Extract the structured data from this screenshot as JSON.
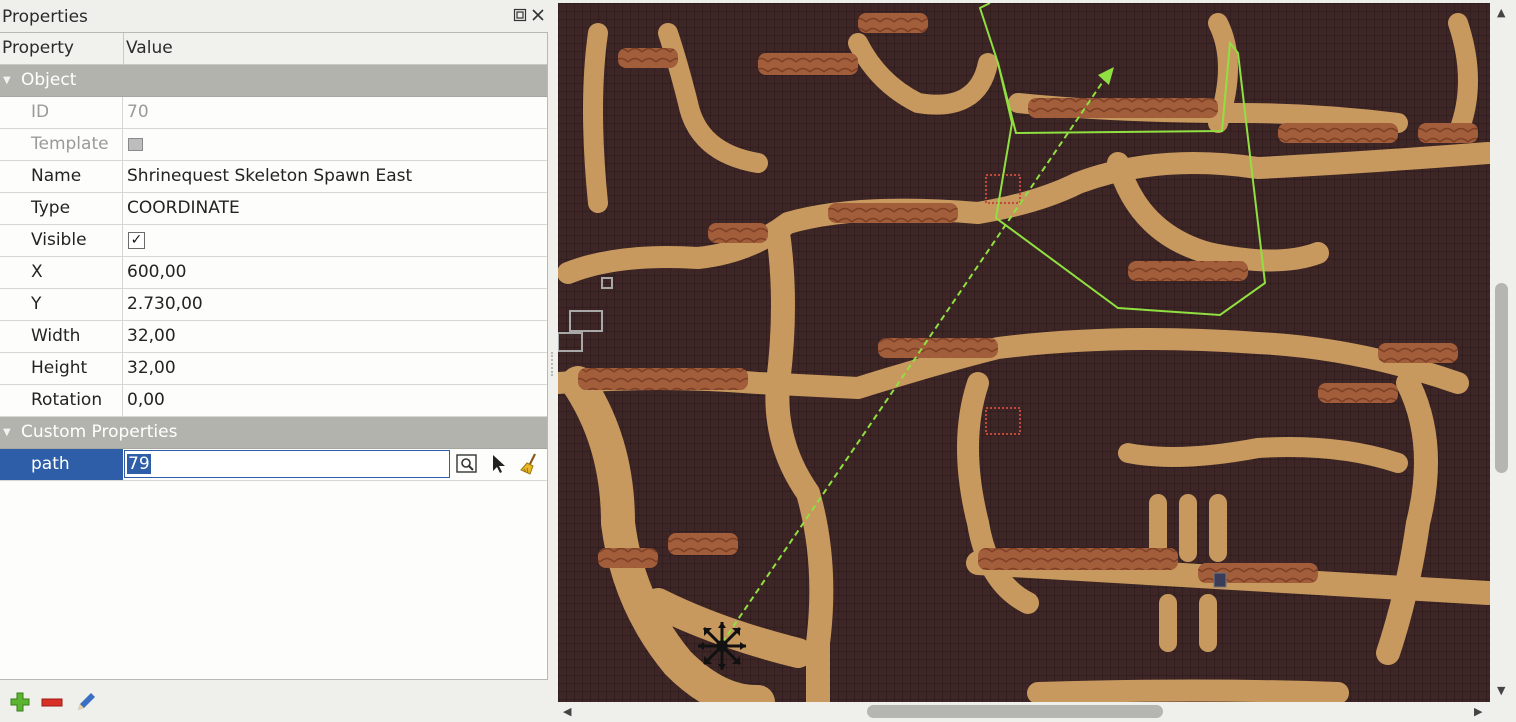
{
  "panel": {
    "title": "Properties",
    "header": {
      "property": "Property",
      "value": "Value"
    },
    "groups": [
      {
        "label": "Object"
      },
      {
        "label": "Custom Properties"
      }
    ],
    "object_rows": [
      {
        "key": "ID",
        "value": "70"
      },
      {
        "key": "Template",
        "value": ""
      },
      {
        "key": "Name",
        "value": "Shrinequest Skeleton Spawn East"
      },
      {
        "key": "Type",
        "value": "COORDINATE"
      },
      {
        "key": "Visible",
        "value": "✓"
      },
      {
        "key": "X",
        "value": "600,00"
      },
      {
        "key": "Y",
        "value": "2.730,00"
      },
      {
        "key": "Width",
        "value": "32,00"
      },
      {
        "key": "Height",
        "value": "32,00"
      },
      {
        "key": "Rotation",
        "value": "0,00"
      }
    ],
    "custom_rows": [
      {
        "key": "path",
        "value": "79"
      }
    ]
  },
  "colors": {
    "selection": "#2f5ea8",
    "group_header": "#b3b3ae",
    "path_line": "#8fe040",
    "cave_floor": "#c8995e",
    "cave_wall": "#a6603c",
    "void": "#3e2626"
  },
  "icons": {
    "float": "float-icon",
    "close": "close-icon",
    "object_ref": "object-reference-icon",
    "pick": "pick-object-icon",
    "clear": "clear-broom-icon",
    "add": "add-property-icon",
    "remove": "remove-property-icon",
    "rename": "rename-property-icon",
    "move": "move-handle-icon"
  }
}
